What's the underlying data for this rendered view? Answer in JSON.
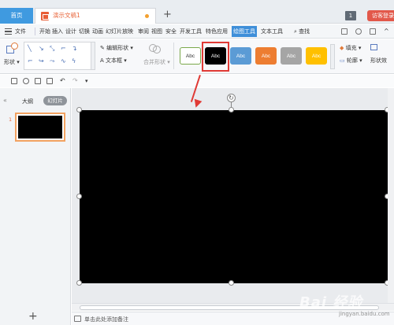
{
  "titlebar": {
    "home_tab": "首页",
    "doc_tab": "演示文稿1",
    "page_count": "1",
    "visitor_login": "访客登录"
  },
  "menu": {
    "file": "文件",
    "items": [
      "开始",
      "插入",
      "设计",
      "切换",
      "动画",
      "幻灯片放映",
      "审阅",
      "视图",
      "安全",
      "开发工具",
      "特色应用",
      "绘图工具",
      "文本工具"
    ],
    "active_item": "绘图工具",
    "search": "查找"
  },
  "ribbon": {
    "shape_label": "形状",
    "edit_shape": "编辑形状",
    "text_box": "文本框",
    "merge_shape": "合并形状",
    "style_buttons": [
      {
        "label": "Abc",
        "bg": "#ffffff",
        "fg": "#333333",
        "border": "#7aa84a"
      },
      {
        "label": "Abc",
        "bg": "#000000",
        "fg": "#ffffff",
        "border": "#000000"
      },
      {
        "label": "Abc",
        "bg": "#5b9bd5",
        "fg": "#ffffff",
        "border": "#5b9bd5"
      },
      {
        "label": "Abc",
        "bg": "#ed7d31",
        "fg": "#ffffff",
        "border": "#ed7d31"
      },
      {
        "label": "Abc",
        "bg": "#a5a5a5",
        "fg": "#ffffff",
        "border": "#a5a5a5"
      },
      {
        "label": "Abc",
        "bg": "#ffc000",
        "fg": "#ffffff",
        "border": "#ffc000"
      }
    ],
    "fill": "填充",
    "outline": "轮廓",
    "effect": "形状效"
  },
  "panel": {
    "outline_tab": "大纲",
    "slides_tab": "幻灯片",
    "slide_number": "1",
    "add_slide": "+"
  },
  "notes": {
    "placeholder": "单击此处添加备注"
  },
  "watermark": {
    "main": "Bai 经验",
    "sub": "jingyan.baidu.com"
  }
}
